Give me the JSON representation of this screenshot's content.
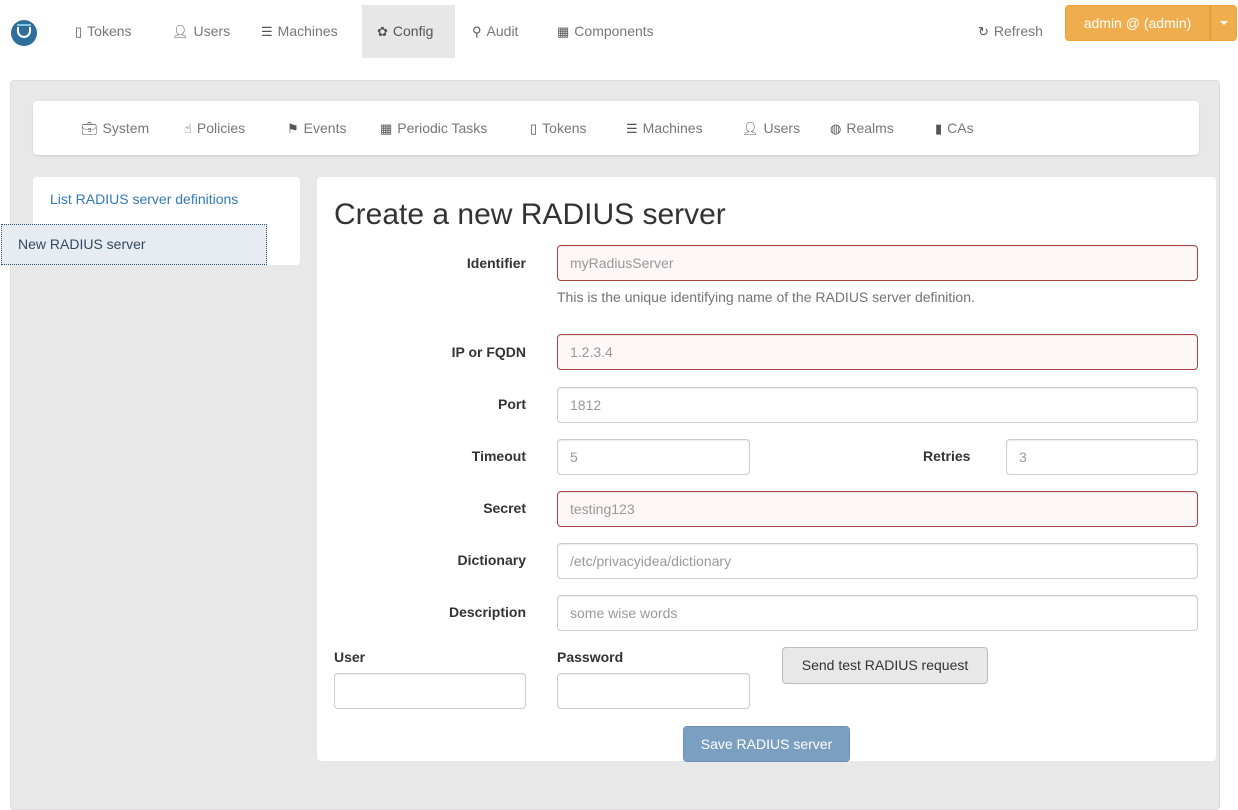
{
  "topnav": {
    "items": [
      {
        "label": "Tokens",
        "icon": "mobile-icon"
      },
      {
        "label": "Users",
        "icon": "user-icon"
      },
      {
        "label": "Machines",
        "icon": "server-icon"
      },
      {
        "label": "Config",
        "icon": "gear-icon",
        "active": true
      },
      {
        "label": "Audit",
        "icon": "search-icon"
      },
      {
        "label": "Components",
        "icon": "calendar-icon"
      }
    ],
    "refresh_label": "Refresh",
    "user_menu_label": "admin @ (admin)"
  },
  "subnav": {
    "items": [
      {
        "label": "System",
        "icon": "briefcase-icon"
      },
      {
        "label": "Policies",
        "icon": "hand-pointer-icon"
      },
      {
        "label": "Events",
        "icon": "flag-icon"
      },
      {
        "label": "Periodic Tasks",
        "icon": "calendar-icon"
      },
      {
        "label": "Tokens",
        "icon": "mobile-icon"
      },
      {
        "label": "Machines",
        "icon": "server-icon"
      },
      {
        "label": "Users",
        "icon": "user-icon"
      },
      {
        "label": "Realms",
        "icon": "globe-icon"
      },
      {
        "label": "CAs",
        "icon": "bookmark-icon"
      }
    ]
  },
  "sidebar": {
    "items": [
      {
        "label": "List RADIUS server definitions"
      },
      {
        "label": "New RADIUS server",
        "active": true
      }
    ]
  },
  "form": {
    "title": "Create a new RADIUS server",
    "identifier": {
      "label": "Identifier",
      "placeholder": "myRadiusServer",
      "help": "This is the unique identifying name of the RADIUS server definition."
    },
    "ip": {
      "label": "IP or FQDN",
      "placeholder": "1.2.3.4"
    },
    "port": {
      "label": "Port",
      "placeholder": "1812"
    },
    "timeout": {
      "label": "Timeout",
      "placeholder": "5"
    },
    "retries": {
      "label": "Retries",
      "placeholder": "3"
    },
    "secret": {
      "label": "Secret",
      "placeholder": "testing123"
    },
    "dictionary": {
      "label": "Dictionary",
      "placeholder": "/etc/privacyidea/dictionary"
    },
    "description": {
      "label": "Description",
      "placeholder": "some wise words"
    },
    "test_user": {
      "label": "User",
      "value": ""
    },
    "test_password": {
      "label": "Password",
      "value": ""
    },
    "test_button": "Send test RADIUS request",
    "save_button": "Save RADIUS server"
  }
}
